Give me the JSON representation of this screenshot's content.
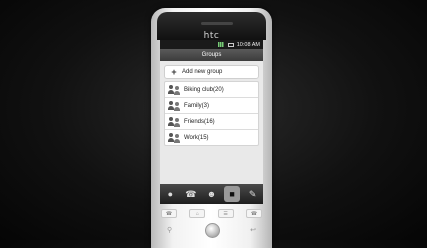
{
  "device": {
    "brand": "htc"
  },
  "status_bar": {
    "time": "10:08 AM"
  },
  "screen": {
    "title": "Groups",
    "add_group_label": "Add new group",
    "groups": [
      {
        "label": "Biking club(20)"
      },
      {
        "label": "Family(3)"
      },
      {
        "label": "Friends(16)"
      },
      {
        "label": "Work(15)"
      }
    ]
  },
  "tabs": [
    {
      "icon": "person-icon",
      "active": false
    },
    {
      "icon": "history-icon",
      "active": false
    },
    {
      "icon": "group-icon",
      "active": false
    },
    {
      "icon": "contact-card-icon",
      "active": true
    },
    {
      "icon": "edit-icon",
      "active": false
    }
  ],
  "colors": {
    "titlebar": "#4a4a4a",
    "tab_active": "#9a9a9a"
  }
}
